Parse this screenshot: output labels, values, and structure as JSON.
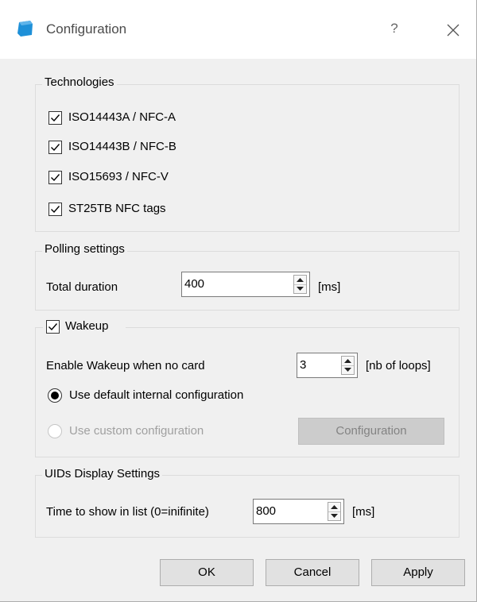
{
  "window": {
    "title": "Configuration",
    "help_label": "?",
    "accent_color": "#1e90d8"
  },
  "technologies": {
    "title": "Technologies",
    "items": [
      {
        "label": "ISO14443A / NFC-A",
        "checked": true
      },
      {
        "label": "ISO14443B / NFC-B",
        "checked": true
      },
      {
        "label": "ISO15693 / NFC-V",
        "checked": true
      },
      {
        "label": "ST25TB NFC tags",
        "checked": true
      }
    ]
  },
  "polling": {
    "title": "Polling settings",
    "duration_label": "Total duration",
    "duration_value": "400",
    "duration_unit": "[ms]"
  },
  "wakeup": {
    "title": "Wakeup",
    "checked": true,
    "enable_label": "Enable Wakeup when no card",
    "loops_value": "3",
    "loops_unit": "[nb of loops]",
    "default_config_label": "Use default internal configuration",
    "custom_config_label": "Use custom configuration",
    "selected": "default",
    "configuration_button": "Configuration"
  },
  "uids": {
    "title": "UIDs Display Settings",
    "time_label": "Time to show in list (0=inifinite)",
    "time_value": "800",
    "time_unit": "[ms]"
  },
  "footer": {
    "ok_label": "OK",
    "cancel_label": "Cancel",
    "apply_label": "Apply"
  },
  "icons": {
    "app": "app-icon",
    "close": "close-icon",
    "check": "check-icon",
    "spin_up": "arrow-up-icon",
    "spin_down": "arrow-down-icon"
  }
}
